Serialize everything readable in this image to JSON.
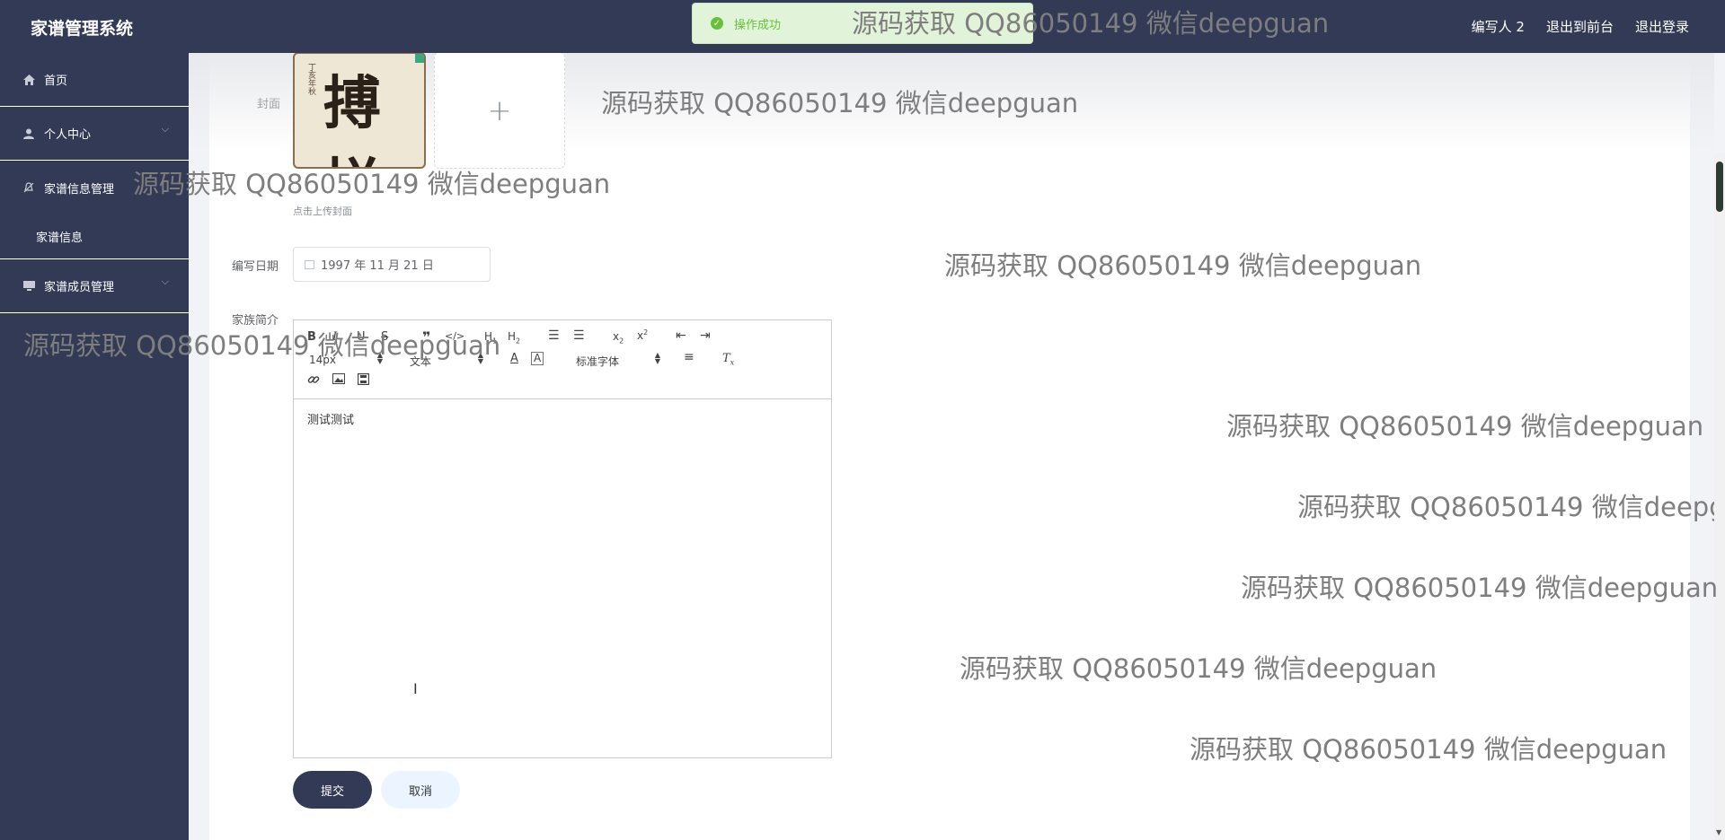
{
  "app": {
    "title": "家谱管理系统"
  },
  "header": {
    "links": [
      "编写人 2",
      "退出到前台",
      "退出登录"
    ]
  },
  "toast": {
    "message": "操作成功"
  },
  "sidebar": {
    "items": [
      {
        "label": "首页",
        "icon": "home-icon"
      },
      {
        "label": "个人中心",
        "icon": "user-icon"
      },
      {
        "label": "家谱信息管理",
        "icon": "bell-off-icon"
      },
      {
        "label": "家谱信息"
      },
      {
        "label": "家谱成员管理",
        "icon": "monitor-icon"
      }
    ]
  },
  "form": {
    "cover_label": "封面",
    "upload_tip": "点击上传封面",
    "date_label": "编写日期",
    "date_value": "1997 年 11 月 21 日",
    "intro_label": "家族简介",
    "editor": {
      "font_size": "14px",
      "text_type": "文本",
      "font_family": "标准字体",
      "content": "测试测试"
    },
    "submit_label": "提交",
    "cancel_label": "取消"
  },
  "watermark": {
    "text": "源码获取 QQ86050149 微信deepguan"
  },
  "colors": {
    "sidebar_bg": "#323a56",
    "success": "#67c23a"
  }
}
